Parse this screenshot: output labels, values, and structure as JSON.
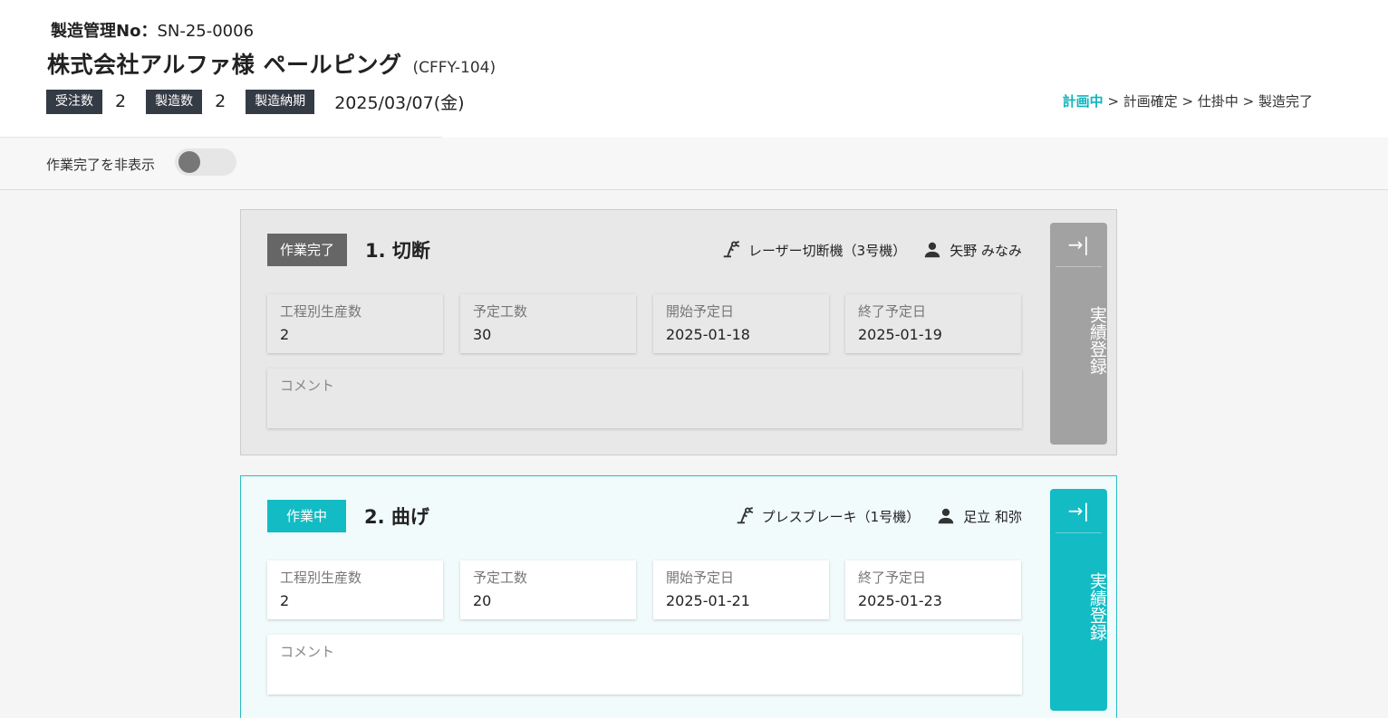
{
  "header": {
    "mgmt_label": "製造管理No：",
    "mgmt_no": "SN-25-0006",
    "title": "株式会社アルファ様 ペールピング",
    "code": "(CFFY-104)",
    "order_qty_label": "受注数",
    "order_qty": "2",
    "mfg_qty_label": "製造数",
    "mfg_qty": "2",
    "due_label": "製造納期",
    "due_date": "2025/03/07(金)",
    "status_flow": {
      "current": "計画中",
      "rest": " > 計画確定 > 仕掛中 > 製造完了"
    }
  },
  "filter": {
    "hide_done_label": "作業完了を非表示",
    "hide_done_on": false
  },
  "processes": [
    {
      "status": "作業完了",
      "name": "1. 切断",
      "machine": "レーザー切断機（3号機）",
      "worker": "矢野 みなみ",
      "fields": [
        {
          "label": "工程別生産数",
          "value": "2"
        },
        {
          "label": "予定工数",
          "value": "30"
        },
        {
          "label": "開始予定日",
          "value": "2025-01-18"
        },
        {
          "label": "終了予定日",
          "value": "2025-01-19"
        }
      ],
      "comment_placeholder": "コメント",
      "side_icon": "→|",
      "side_label": "実績登録"
    },
    {
      "status": "作業中",
      "name": "2. 曲げ",
      "machine": "プレスブレーキ（1号機）",
      "worker": "足立 和弥",
      "fields": [
        {
          "label": "工程別生産数",
          "value": "2"
        },
        {
          "label": "予定工数",
          "value": "20"
        },
        {
          "label": "開始予定日",
          "value": "2025-01-21"
        },
        {
          "label": "終了予定日",
          "value": "2025-01-23"
        }
      ],
      "comment_placeholder": "コメント",
      "side_icon": "→|",
      "side_label": "実績登録"
    }
  ],
  "colors": {
    "accent": "#13bcc4",
    "tag_bg": "#353b45",
    "done_badge": "#666666",
    "done_button": "#a2a2a2"
  }
}
